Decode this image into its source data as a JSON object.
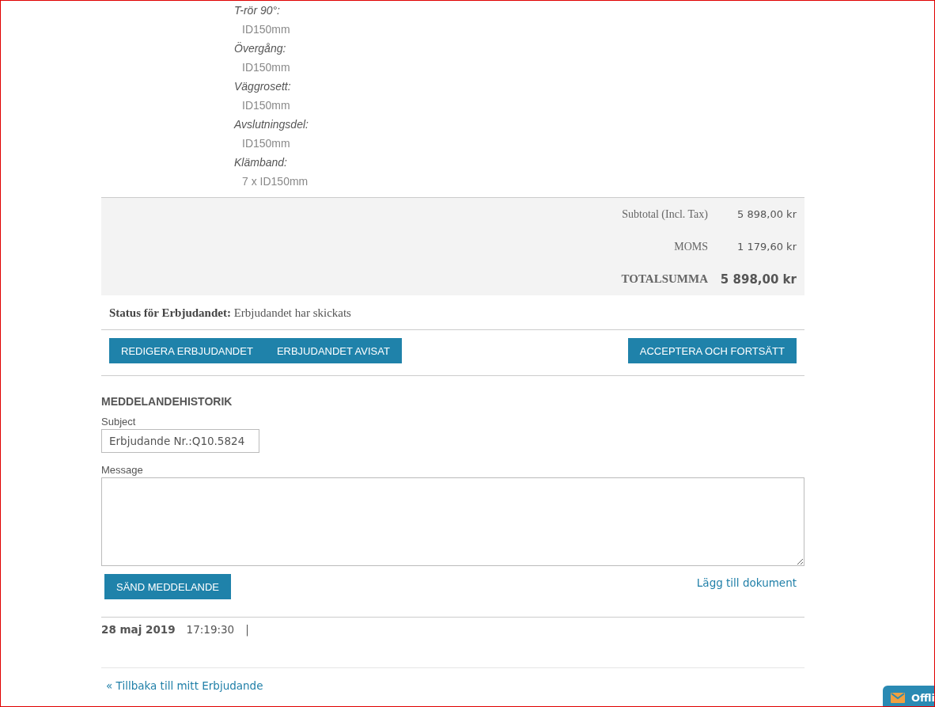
{
  "options": [
    {
      "label": "T-rör 90°:",
      "value": "ID150mm"
    },
    {
      "label": "Övergång:",
      "value": "ID150mm"
    },
    {
      "label": "Väggrosett:",
      "value": "ID150mm"
    },
    {
      "label": "Avslutningsdel:",
      "value": "ID150mm"
    },
    {
      "label": "Klämband:",
      "value": "7 x ID150mm"
    }
  ],
  "totals": [
    {
      "label": "Subtotal (Incl. Tax)",
      "value": "5 898,00 kr",
      "kind": "normal"
    },
    {
      "label": "MOMS",
      "value": "1 179,60 kr",
      "kind": "normal"
    },
    {
      "label": "TOTALSUMMA",
      "value": "5 898,00 kr",
      "kind": "grand"
    }
  ],
  "status": {
    "label": "Status för Erbjudandet:",
    "value": "Erbjudandet har skickats"
  },
  "actions_left": [
    "REDIGERA ERBJUDANDET",
    "ERBJUDANDET AVISAT"
  ],
  "actions_right": [
    "ACCEPTERA OCH FORTSÄTT"
  ],
  "messages": {
    "heading": "MEDDELANDEHISTORIK",
    "subject_label": "Subject",
    "subject_value": "Erbjudande Nr.:Q10.5824",
    "message_label": "Message",
    "send_button": "SÄND MEDDELANDE",
    "attach_link": "Lägg till dokument"
  },
  "history": [
    {
      "date": "28 maj 2019",
      "time": "17:19:30",
      "separator": "|"
    }
  ],
  "back_link": "« Tillbaka till mitt Erbjudande",
  "chat_tab": {
    "label": "Offli"
  }
}
